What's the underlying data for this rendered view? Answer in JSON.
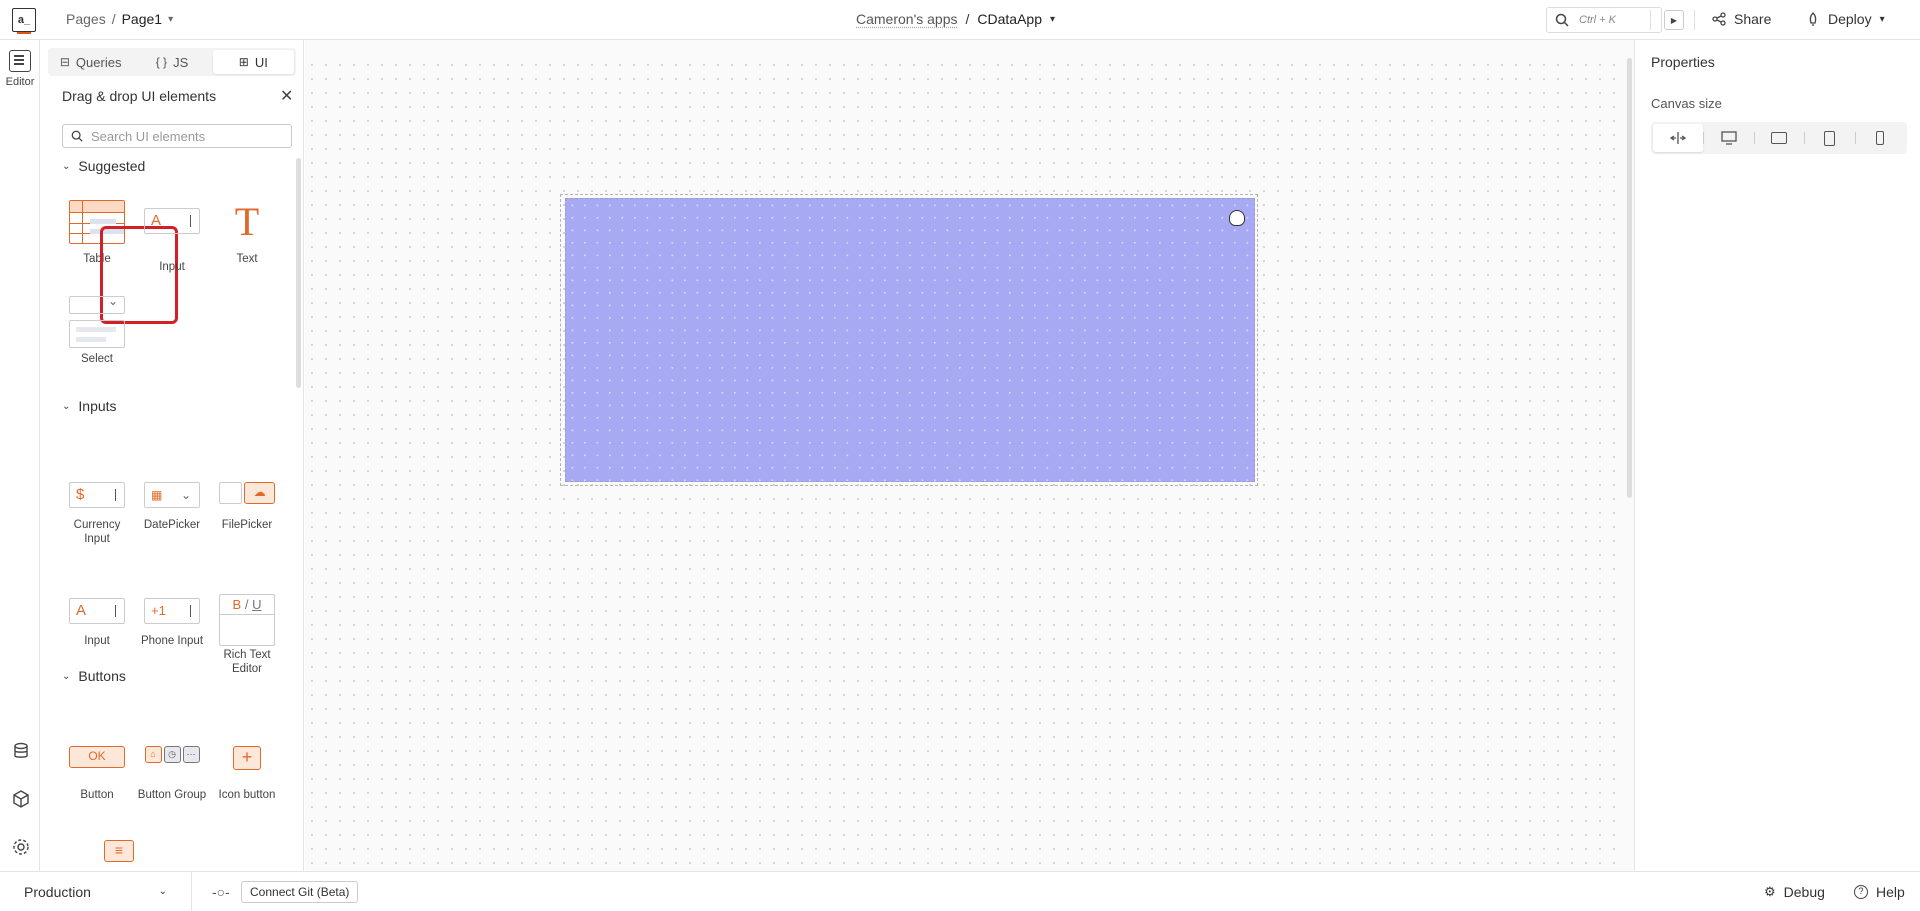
{
  "header": {
    "logo": "a_",
    "breadcrumb_root": "Pages",
    "breadcrumb_sep": "/",
    "breadcrumb_page": "Page1",
    "workspace": "Cameron's apps",
    "title_sep": "/",
    "app_name": "CDataApp",
    "search_shortcut": "Ctrl + K",
    "share_label": "Share",
    "deploy_label": "Deploy"
  },
  "rail": {
    "editor_label": "Editor",
    "icons": [
      "editor-icon",
      "datasource-icon",
      "packages-icon",
      "settings-icon"
    ]
  },
  "panel": {
    "tabs": [
      {
        "label": "Queries",
        "icon": "queries-icon"
      },
      {
        "label": "JS",
        "icon": "braces-icon"
      },
      {
        "label": "UI",
        "icon": "widgets-icon",
        "active": true
      }
    ],
    "heading": "Drag & drop UI elements",
    "search_placeholder": "Search UI elements",
    "sections": {
      "suggested": "Suggested",
      "inputs": "Inputs",
      "buttons": "Buttons"
    },
    "suggested": [
      "Table",
      "Input",
      "Text",
      "Select"
    ],
    "inputs": [
      "Currency Input",
      "DatePicker",
      "FilePicker",
      "Input",
      "Phone Input",
      "Rich Text Editor"
    ],
    "buttons": [
      "Button",
      "Button Group",
      "Icon button"
    ],
    "widget_glyphs": {
      "input_a": "A",
      "currency": "$",
      "phone": "+1",
      "rte_bold": "B",
      "rte_slash": "/",
      "rte_underline": "U",
      "ok": "OK",
      "plus": "+",
      "more": "⋯"
    },
    "highlighted_widget": "Table"
  },
  "properties": {
    "title": "Properties",
    "canvas_size_label": "Canvas size",
    "canvas_size_options": [
      "fluid",
      "desktop",
      "tablet-landscape",
      "tablet",
      "mobile"
    ],
    "selected": "fluid"
  },
  "footer": {
    "environment": "Production",
    "git_button": "Connect Git (Beta)",
    "debug_label": "Debug",
    "help_label": "Help"
  },
  "colors": {
    "accent": "#e06a2b",
    "drop_zone": "#a7aaf2",
    "highlight": "#d32027"
  }
}
